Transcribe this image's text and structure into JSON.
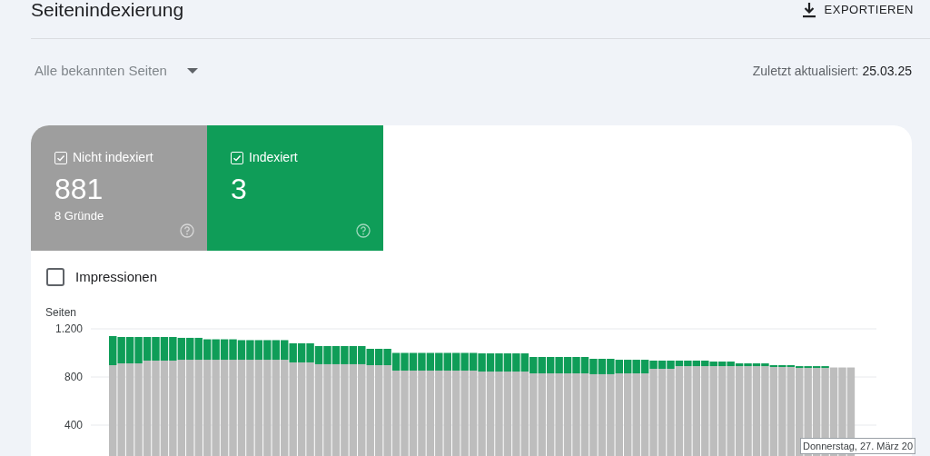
{
  "header": {
    "title": "Seitenindexierung",
    "export_label": "EXPORTIEREN"
  },
  "filter": {
    "dropdown": "Alle bekannten Seiten",
    "updated_label": "Zuletzt aktualisiert:",
    "updated_value": "25.03.25"
  },
  "summary_cards": [
    {
      "label": "Nicht indexiert",
      "checked": true,
      "value": "881",
      "subtitle": "8 Gründe",
      "color": "#9e9e9e"
    },
    {
      "label": "Indexiert",
      "checked": true,
      "value": "3",
      "color": "#0f9d58"
    }
  ],
  "impressions": {
    "label": "Impressionen",
    "checked": false
  },
  "chart": {
    "chart_data": {
      "type": "bar",
      "stacked": true,
      "ylabel": "Seiten",
      "ylim": [
        0,
        1200
      ],
      "yticks": [
        {
          "value": 400,
          "label": "400"
        },
        {
          "value": 800,
          "label": "800"
        },
        {
          "value": 1200,
          "label": "1.200"
        }
      ],
      "series": [
        {
          "color": "#bdbdbd",
          "values": [
            898,
            913,
            913,
            913,
            936,
            936,
            936,
            936,
            943,
            943,
            943,
            943,
            943,
            943,
            943,
            943,
            943,
            943,
            943,
            943,
            943,
            921,
            921,
            921,
            906,
            906,
            906,
            906,
            906,
            906,
            898,
            898,
            898,
            853,
            853,
            853,
            853,
            853,
            853,
            853,
            853,
            853,
            853,
            845,
            845,
            845,
            845,
            845,
            845,
            830,
            830,
            830,
            830,
            830,
            830,
            830,
            823,
            823,
            823,
            830,
            830,
            830,
            830,
            868,
            868,
            868,
            890,
            890,
            890,
            890,
            890,
            890,
            890,
            890,
            890,
            890,
            890,
            883,
            883,
            883,
            875,
            875,
            875,
            875,
            879,
            879,
            879
          ]
        },
        {
          "color": "#0f9d58",
          "values": [
            242,
            219,
            219,
            219,
            196,
            196,
            196,
            196,
            182,
            182,
            182,
            170,
            170,
            170,
            170,
            163,
            163,
            163,
            163,
            163,
            163,
            159,
            159,
            159,
            151,
            151,
            151,
            151,
            151,
            151,
            136,
            136,
            136,
            147,
            147,
            147,
            147,
            147,
            147,
            147,
            147,
            147,
            147,
            151,
            151,
            151,
            151,
            151,
            151,
            136,
            136,
            136,
            136,
            136,
            136,
            136,
            128,
            128,
            128,
            113,
            113,
            113,
            113,
            68,
            68,
            68,
            46,
            46,
            46,
            46,
            38,
            38,
            38,
            23,
            23,
            23,
            23,
            15,
            15,
            15,
            15,
            15,
            15,
            15,
            0,
            0,
            0
          ]
        }
      ]
    },
    "tooltip": "Donnerstag, 27. März 20"
  }
}
